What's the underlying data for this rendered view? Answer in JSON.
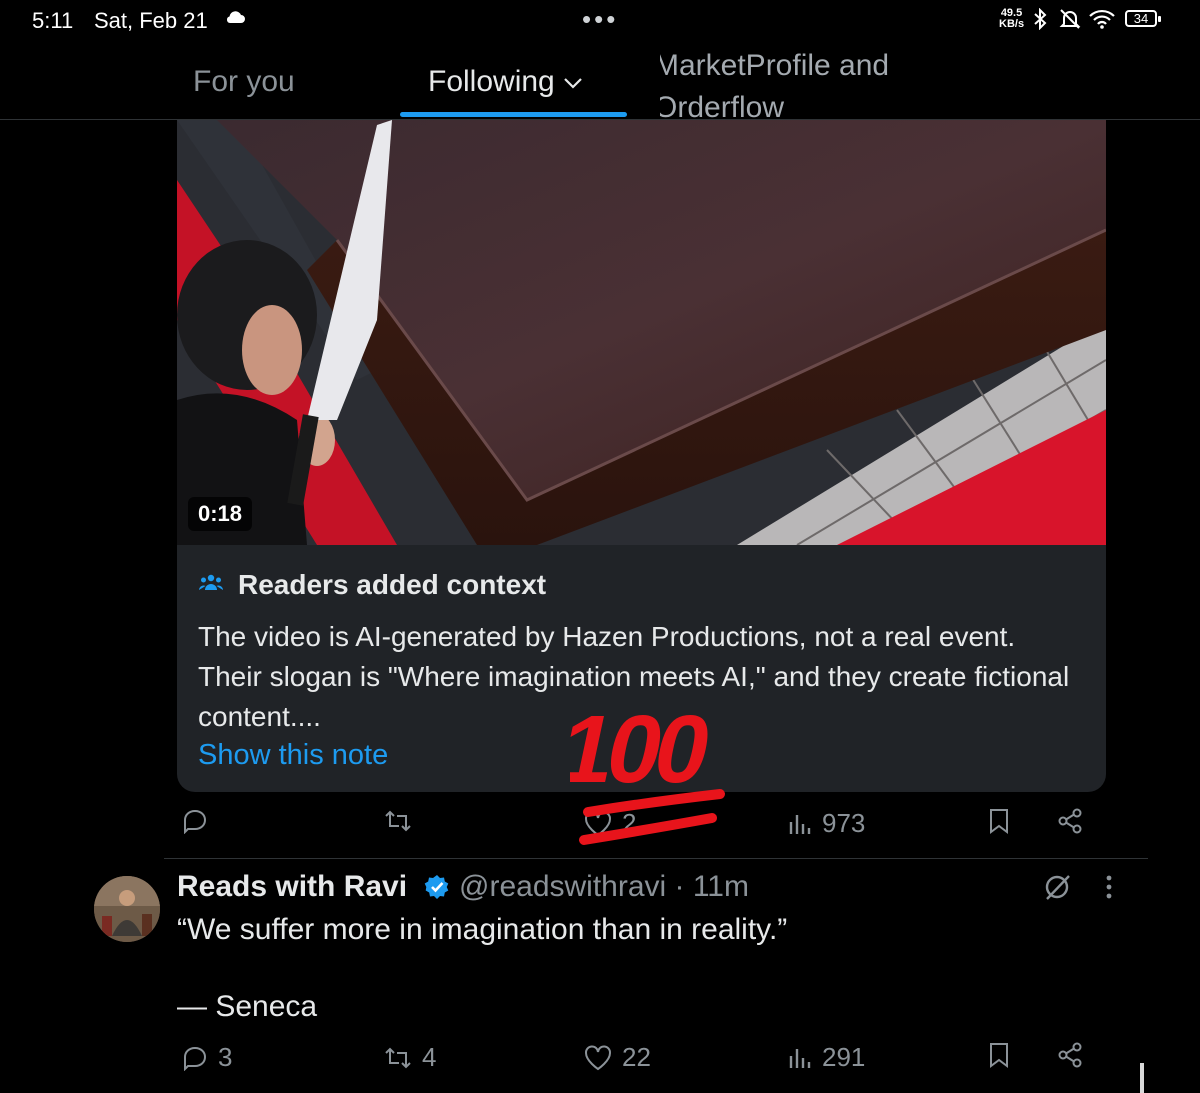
{
  "status_bar": {
    "time": "5:11",
    "date": "Sat, Feb 21",
    "net_speed_value": "49.5",
    "net_speed_unit": "KB/s",
    "battery": "34"
  },
  "tabs": {
    "for_you": "For you",
    "following": "Following",
    "list_line1": "MarketProfile and",
    "list_line2": "Orderflow"
  },
  "tweet1": {
    "video_duration": "0:18",
    "note": {
      "title": "Readers added context",
      "text": "The video is AI-generated by Hazen Productions, not a real event. Their slogan is \"Where imagination meets AI,\" and they create fictional content....",
      "link": "Show this note"
    },
    "actions": {
      "replies": "",
      "reposts": "",
      "likes": "2",
      "views": "973"
    },
    "overlay_emoji": "100"
  },
  "tweet2": {
    "author": "Reads with Ravi",
    "handle_time": "@readswithravi · 11m",
    "text": "“We suffer more in imagination than in reality.”",
    "signature": "— Seneca",
    "actions": {
      "replies": "3",
      "reposts": "4",
      "likes": "22",
      "views": "291"
    }
  },
  "colors": {
    "accent": "#1d9bf0",
    "muted": "#8b9298",
    "note_bg": "#202327",
    "emoji_red": "#e8141b"
  }
}
